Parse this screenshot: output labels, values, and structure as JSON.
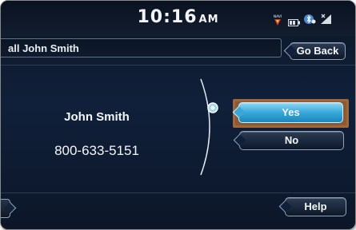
{
  "status_bar": {
    "time": "10:16",
    "ampm": "AM",
    "icons": [
      "navi-icon",
      "battery-icon",
      "bluetooth-icon",
      "signal-icon"
    ],
    "navi_label": "NAVI"
  },
  "call_bar": {
    "text": "all John Smith",
    "go_back_label": "Go Back"
  },
  "contact": {
    "name": "John Smith",
    "number": "800-633-5151"
  },
  "options": {
    "yes_label": "Yes",
    "no_label": "No",
    "selected": "Yes"
  },
  "footer": {
    "help_label": "Help"
  },
  "colors": {
    "background": "#0f1b2d",
    "highlight": "#a0673c",
    "selected_button": "#36a8d9",
    "text": "#f4f6f9"
  }
}
